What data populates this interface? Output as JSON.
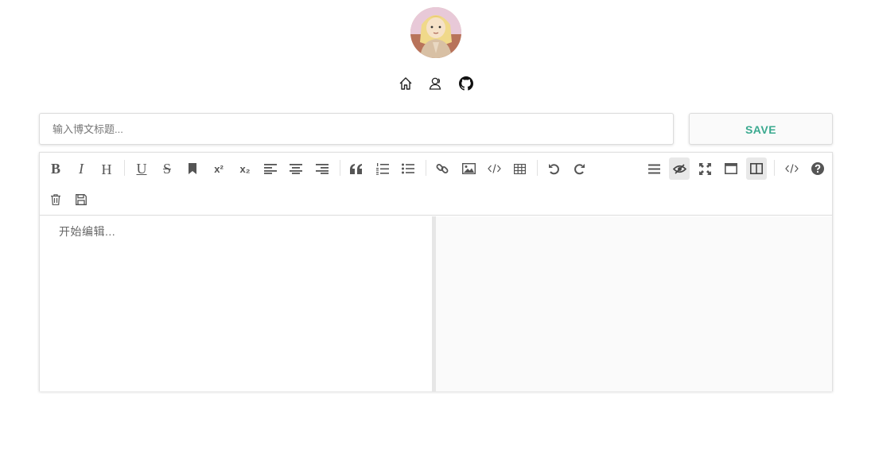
{
  "header": {
    "avatar_alt": "avatar",
    "nav": [
      {
        "icon": "home-icon"
      },
      {
        "icon": "user-icon"
      },
      {
        "icon": "github-icon"
      }
    ]
  },
  "form": {
    "title_placeholder": "输入博文标题...",
    "title_value": "",
    "save_label": "SAVE"
  },
  "editor": {
    "placeholder": "开始编辑...",
    "toolbar": {
      "bold": "B",
      "italic": "I",
      "header": "H",
      "underline": "U",
      "strikethrough": "S",
      "superscript": "x²",
      "subscript": "x₂"
    }
  },
  "colors": {
    "accent": "#3aa98f",
    "icon": "#555555",
    "preview_bg": "#fafafa"
  }
}
